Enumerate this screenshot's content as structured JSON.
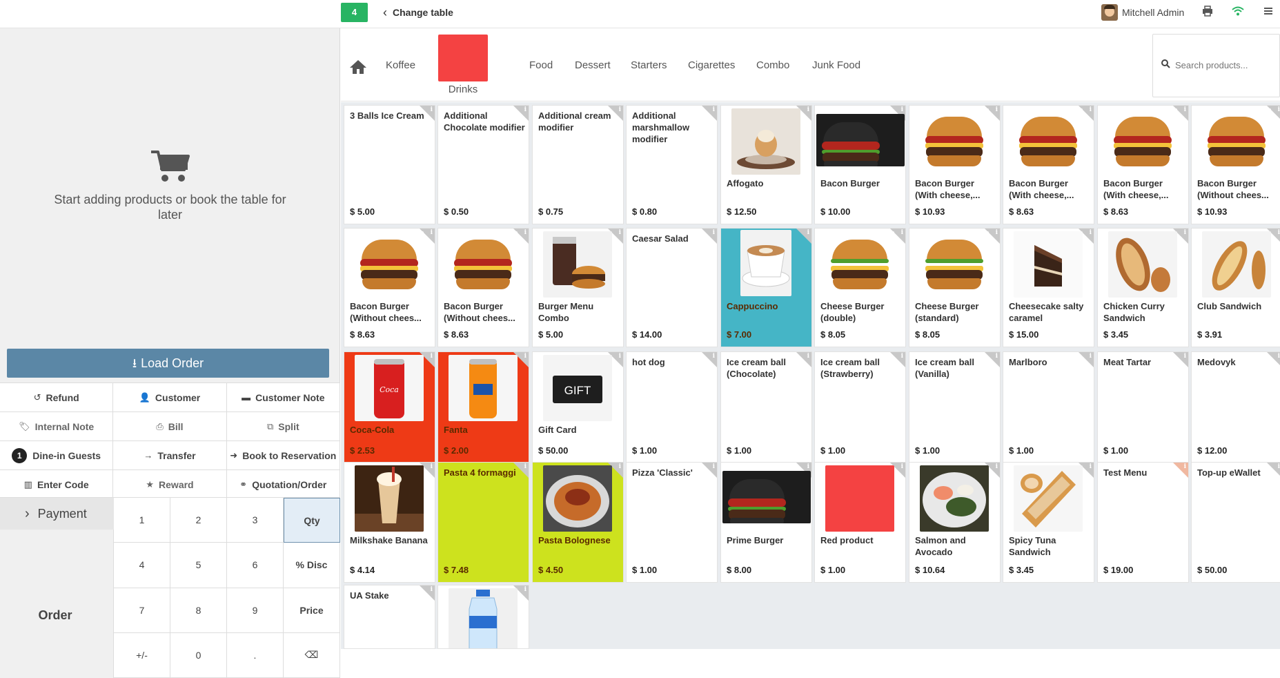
{
  "topbar": {
    "table_number": "4",
    "change_table_label": "Change table",
    "user_name": "Mitchell Admin"
  },
  "cart": {
    "empty_message": "Start adding products or book the table for later"
  },
  "actions": {
    "load_order": "Load Order",
    "refund": "Refund",
    "customer": "Customer",
    "customer_note": "Customer Note",
    "internal_note": "Internal Note",
    "bill": "Bill",
    "split": "Split",
    "guests_count": "1",
    "dine_in_guests": "Dine-in Guests",
    "transfer": "Transfer",
    "book_reservation": "Book to Reservation",
    "enter_code": "Enter Code",
    "reward": "Reward",
    "quotation_order": "Quotation/Order"
  },
  "numpad": {
    "payment": "Payment",
    "order": "Order",
    "keys": [
      "1",
      "2",
      "3",
      "Qty",
      "4",
      "5",
      "6",
      "% Disc",
      "7",
      "8",
      "9",
      "Price",
      "+/-",
      "0",
      ".",
      "⌫"
    ]
  },
  "categories": {
    "items": [
      "Koffee",
      "Drinks",
      "Food",
      "Dessert",
      "Starters",
      "Cigarettes",
      "Combo",
      "Junk Food"
    ],
    "selected": "Drinks",
    "drinks_color": "#f44242"
  },
  "search": {
    "placeholder": "Search products..."
  },
  "products": [
    {
      "name": "3 Balls Ice Cream",
      "price": "$ 5.00"
    },
    {
      "name": "Additional Chocolate modifier",
      "price": "$ 0.50"
    },
    {
      "name": "Additional cream modifier",
      "price": "$ 0.75"
    },
    {
      "name": "Additional marshmallow modifier",
      "price": "$ 0.80"
    },
    {
      "name": "Affogato",
      "price": "$ 12.50"
    },
    {
      "name": "Bacon Burger",
      "price": "$ 10.00"
    },
    {
      "name": "Bacon Burger (With cheese,...",
      "price": "$ 10.93"
    },
    {
      "name": "Bacon Burger (With cheese,...",
      "price": "$ 8.63"
    },
    {
      "name": "Bacon Burger (With cheese,...",
      "price": "$ 8.63"
    },
    {
      "name": "Bacon Burger (Without chees...",
      "price": "$ 10.93"
    },
    {
      "name": "Bacon Burger (Without chees...",
      "price": "$ 8.63"
    },
    {
      "name": "Bacon Burger (Without chees...",
      "price": "$ 8.63"
    },
    {
      "name": "Burger Menu Combo",
      "price": "$ 5.00"
    },
    {
      "name": "Caesar Salad",
      "price": "$ 14.00"
    },
    {
      "name": "Cappuccino",
      "price": "$ 7.00"
    },
    {
      "name": "Cheese Burger (double)",
      "price": "$ 8.05"
    },
    {
      "name": "Cheese Burger (standard)",
      "price": "$ 8.05"
    },
    {
      "name": "Cheesecake salty caramel",
      "price": "$ 15.00"
    },
    {
      "name": "Chicken Curry Sandwich",
      "price": "$ 3.45"
    },
    {
      "name": "Club Sandwich",
      "price": "$ 3.91"
    },
    {
      "name": "Coca-Cola",
      "price": "$ 2.53"
    },
    {
      "name": "Fanta",
      "price": "$ 2.00"
    },
    {
      "name": "Gift Card",
      "price": "$ 50.00",
      "image_text": "GIFT"
    },
    {
      "name": "hot dog",
      "price": "$ 1.00"
    },
    {
      "name": "Ice cream ball (Chocolate)",
      "price": "$ 1.00"
    },
    {
      "name": "Ice cream ball (Strawberry)",
      "price": "$ 1.00"
    },
    {
      "name": "Ice cream ball (Vanilla)",
      "price": "$ 1.00"
    },
    {
      "name": "Marlboro",
      "price": "$ 1.00"
    },
    {
      "name": "Meat Tartar",
      "price": "$ 1.00"
    },
    {
      "name": "Medovyk",
      "price": "$ 12.00"
    },
    {
      "name": "Milkshake Banana",
      "price": "$ 4.14"
    },
    {
      "name": "Pasta 4 formaggi",
      "price": "$ 7.48"
    },
    {
      "name": "Pasta Bolognese",
      "price": "$ 4.50"
    },
    {
      "name": "Pizza 'Classic'",
      "price": "$ 1.00"
    },
    {
      "name": "Prime Burger",
      "price": "$ 8.00"
    },
    {
      "name": "Red product",
      "price": "$ 1.00"
    },
    {
      "name": "Salmon and Avocado",
      "price": "$ 10.64"
    },
    {
      "name": "Spicy Tuna Sandwich",
      "price": "$ 3.45"
    },
    {
      "name": "Test Menu",
      "price": "$ 19.00"
    },
    {
      "name": "Top-up eWallet",
      "price": "$ 50.00"
    },
    {
      "name": "UA Stake",
      "price": ""
    },
    {
      "name": "",
      "price": ""
    }
  ],
  "colors": {
    "cappuccino_bg": "#45b5c6",
    "coke_bg": "#ee3a16",
    "pasta_bg": "#cde21e",
    "red_product": "#f44242",
    "table_badge": "#28b463",
    "load_order_bg": "#5b87a6"
  }
}
